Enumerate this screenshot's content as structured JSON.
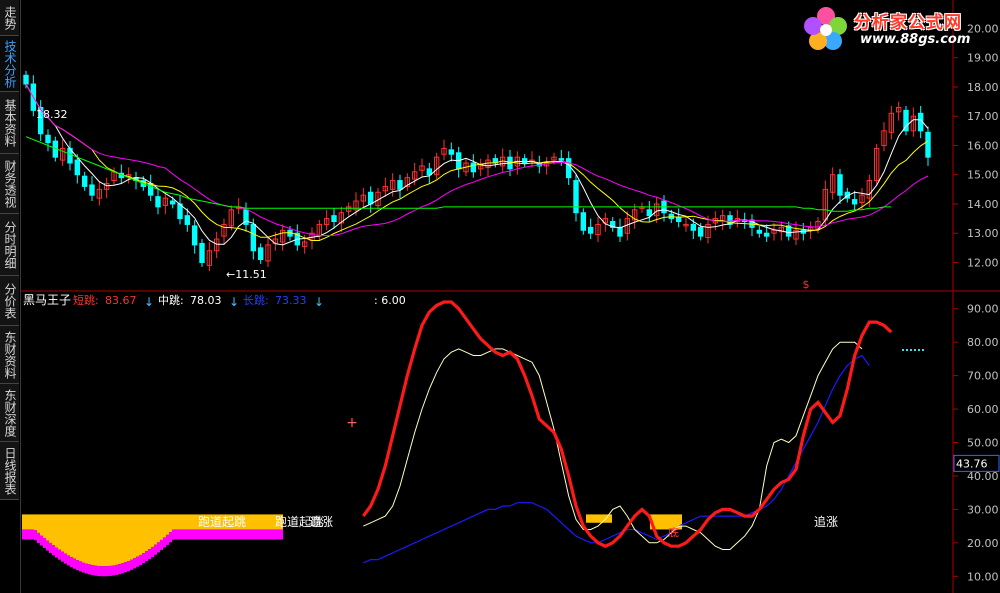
{
  "sidebar": {
    "tabs": [
      {
        "label": "走势",
        "active": false
      },
      {
        "label": "技术分析",
        "active": true
      },
      {
        "label": "基本资料",
        "active": false
      },
      {
        "label": "财务透视",
        "active": false
      },
      {
        "label": "分时明细",
        "active": false
      },
      {
        "label": "分价表",
        "active": false
      },
      {
        "label": "东财资料",
        "active": false
      },
      {
        "label": "东财深度",
        "active": false
      },
      {
        "label": "日线报表",
        "active": false
      }
    ]
  },
  "logo": {
    "brand": "分析家公式网",
    "url": "www.88gs.com"
  },
  "colors": {
    "ma5": "#ffffff",
    "ma10": "#ffff00",
    "ma20": "#ff00ff",
    "ma60": "#00ff00",
    "up_candle": "#ff3030",
    "down_candle": "#00ffff",
    "short_line": "#ff1a1a",
    "mid_line": "#ffffc0",
    "long_line": "#1a1aff",
    "fill_yellow": "#ffc000",
    "fill_magenta": "#ff00ff",
    "axis": "#b00000"
  },
  "chart_data": [
    {
      "type": "candlestick",
      "title": "",
      "ylim": [
        11.4,
        20.7
      ],
      "y_ticks": [
        "20.00",
        "19.00",
        "18.00",
        "17.00",
        "16.00",
        "15.00",
        "14.00",
        "13.00",
        "12.00"
      ],
      "annotations": {
        "high_label": "18.32",
        "low_label": "←11.51",
        "marker": "$"
      },
      "close": [
        18.1,
        17.2,
        16.4,
        16.1,
        15.6,
        15.9,
        15.4,
        15.0,
        14.6,
        14.3,
        14.5,
        14.7,
        15.1,
        14.9,
        15.0,
        14.8,
        14.6,
        14.3,
        13.9,
        14.2,
        14.0,
        13.5,
        13.3,
        12.6,
        12.0,
        12.4,
        12.8,
        13.3,
        13.8,
        13.9,
        13.3,
        12.4,
        12.1,
        12.6,
        12.8,
        13.1,
        12.9,
        12.6,
        12.7,
        13.0,
        13.3,
        13.5,
        13.4,
        13.7,
        13.9,
        14.1,
        14.3,
        14.0,
        14.4,
        14.6,
        14.8,
        14.5,
        14.9,
        15.1,
        15.3,
        15.0,
        15.6,
        15.9,
        15.7,
        15.2,
        15.4,
        15.1,
        15.3,
        15.5,
        15.4,
        15.6,
        15.2,
        15.6,
        15.4,
        15.5,
        15.3,
        15.4,
        15.6,
        15.5,
        14.9,
        13.7,
        13.1,
        13.0,
        13.3,
        13.5,
        13.2,
        12.9,
        13.5,
        13.8,
        13.9,
        13.6,
        14.0,
        13.7,
        13.5,
        13.4,
        13.3,
        13.1,
        12.9,
        13.3,
        13.5,
        13.6,
        13.3,
        13.5,
        13.4,
        13.2,
        13.0,
        12.9,
        13.1,
        13.2,
        12.9,
        13.1,
        13.0,
        13.2,
        13.4,
        14.5,
        15.0,
        14.3,
        14.2,
        14.0,
        14.3,
        14.8,
        15.9,
        16.5,
        17.1,
        17.3,
        16.5,
        17.0,
        16.5,
        15.6
      ],
      "series": [
        {
          "name": "MA60",
          "values": [
            16.3,
            16.2,
            16.1,
            16.0,
            15.9,
            15.8,
            15.7,
            15.6,
            15.5,
            15.4,
            15.3,
            15.2,
            15.1,
            15.0,
            14.9,
            14.8,
            14.7,
            14.6,
            14.5,
            14.4,
            14.35,
            14.3,
            14.2,
            14.15,
            14.1,
            14.05,
            14.0,
            13.95,
            13.9,
            13.9,
            13.85,
            13.85,
            13.85,
            13.85,
            13.85,
            13.85,
            13.85,
            13.85,
            13.85,
            13.85,
            13.85,
            13.85,
            13.85,
            13.85,
            13.85,
            13.85,
            13.85,
            13.85,
            13.85,
            13.85,
            13.85,
            13.85,
            13.85,
            13.85,
            13.85,
            13.85,
            13.85,
            13.9,
            13.9,
            13.9,
            13.9,
            13.9,
            13.9,
            13.9,
            13.9,
            13.9,
            13.9,
            13.9,
            13.9,
            13.9,
            13.9,
            13.9,
            13.9,
            13.9,
            13.9,
            13.9,
            13.9,
            13.9,
            13.9,
            13.9,
            13.9,
            13.9,
            13.9,
            13.9,
            13.9,
            13.9,
            13.9,
            13.9,
            13.9,
            13.9,
            13.9,
            13.9,
            13.9,
            13.9,
            13.9,
            13.9,
            13.9,
            13.9,
            13.9,
            13.9,
            13.9,
            13.9,
            13.9,
            13.9,
            13.9,
            13.9,
            13.85,
            13.85,
            13.8,
            13.8,
            13.75,
            13.75,
            13.75,
            13.8,
            13.8,
            13.85,
            13.85,
            13.9,
            13.9
          ]
        }
      ]
    },
    {
      "type": "line",
      "title": "黑马王子",
      "ylim": [
        5,
        95
      ],
      "y_ticks": [
        "90.00",
        "80.00",
        "70.00",
        "60.00",
        "50.00",
        "40.00",
        "30.00",
        "20.00",
        "10.00"
      ],
      "current_value": "43.76",
      "legend": [
        {
          "name": "短跳",
          "value": "83.67",
          "color": "#ff3030"
        },
        {
          "name": "中跳",
          "value": "78.03",
          "color": "#ffffff"
        },
        {
          "name": "长跳",
          "value": "73.33",
          "color": "#2040ff"
        },
        {
          "name": "",
          "value": ": 6.00",
          "color": "#ffffff"
        }
      ],
      "annotations": [
        "跑道起跳",
        "跑道起跳",
        "追涨",
        "追涨",
        "底"
      ],
      "series": [
        {
          "name": "短跳",
          "values": [
            null,
            null,
            null,
            null,
            null,
            null,
            null,
            null,
            null,
            null,
            null,
            null,
            null,
            null,
            null,
            null,
            null,
            null,
            null,
            null,
            null,
            null,
            null,
            null,
            null,
            null,
            null,
            null,
            null,
            null,
            null,
            null,
            null,
            null,
            null,
            null,
            null,
            null,
            null,
            null,
            null,
            null,
            null,
            null,
            null,
            null,
            28,
            31,
            36,
            43,
            52,
            61,
            70,
            78,
            85,
            89,
            91,
            92,
            92,
            90,
            87,
            84,
            81,
            79,
            77,
            76,
            77,
            75,
            70,
            64,
            57,
            55,
            53,
            48,
            40,
            31,
            25,
            22,
            20,
            19,
            20,
            22,
            25,
            28,
            30,
            28,
            22,
            20,
            19,
            19,
            20,
            22,
            24,
            27,
            29,
            30,
            30,
            29,
            28,
            28,
            30,
            33,
            36,
            38,
            39,
            42,
            52,
            60,
            62,
            59,
            56,
            58,
            66,
            76,
            82,
            86,
            86,
            85,
            83
          ]
        },
        {
          "name": "中跳",
          "values": [
            null,
            null,
            null,
            null,
            null,
            null,
            null,
            null,
            null,
            null,
            null,
            null,
            null,
            null,
            null,
            null,
            null,
            null,
            null,
            null,
            null,
            null,
            null,
            null,
            null,
            null,
            null,
            null,
            null,
            null,
            null,
            null,
            null,
            null,
            null,
            null,
            null,
            null,
            null,
            null,
            null,
            null,
            null,
            null,
            null,
            null,
            25,
            26,
            27,
            28,
            31,
            37,
            45,
            53,
            60,
            66,
            71,
            75,
            77,
            78,
            77,
            76,
            76,
            77,
            78,
            78,
            77,
            76,
            75,
            74,
            70,
            62,
            54,
            44,
            34,
            27,
            24,
            24,
            25,
            27,
            30,
            31,
            28,
            24,
            22,
            20,
            20,
            21,
            23,
            25,
            25,
            24,
            23,
            21,
            19,
            18,
            18,
            20,
            22,
            25,
            30,
            43,
            50,
            51,
            50,
            52,
            58,
            64,
            70,
            74,
            78,
            80,
            80,
            80,
            78
          ]
        },
        {
          "name": "长跳",
          "values": [
            null,
            null,
            null,
            null,
            null,
            null,
            null,
            null,
            null,
            null,
            null,
            null,
            null,
            null,
            null,
            null,
            null,
            null,
            null,
            null,
            null,
            null,
            null,
            null,
            null,
            null,
            null,
            null,
            null,
            null,
            null,
            null,
            null,
            null,
            null,
            null,
            null,
            null,
            null,
            null,
            null,
            null,
            null,
            null,
            null,
            null,
            14,
            15,
            15,
            16,
            17,
            18,
            19,
            20,
            21,
            22,
            23,
            24,
            25,
            26,
            27,
            28,
            29,
            30,
            30,
            31,
            31,
            32,
            32,
            32,
            31,
            30,
            28,
            26,
            24,
            22,
            21,
            20,
            20,
            21,
            22,
            23,
            24,
            24,
            23,
            22,
            21,
            22,
            23,
            25,
            26,
            27,
            28,
            28,
            28,
            28,
            28,
            28,
            28,
            29,
            30,
            31,
            33,
            36,
            40,
            44,
            48,
            52,
            56,
            61,
            66,
            70,
            73,
            75,
            76,
            73
          ]
        }
      ]
    }
  ]
}
